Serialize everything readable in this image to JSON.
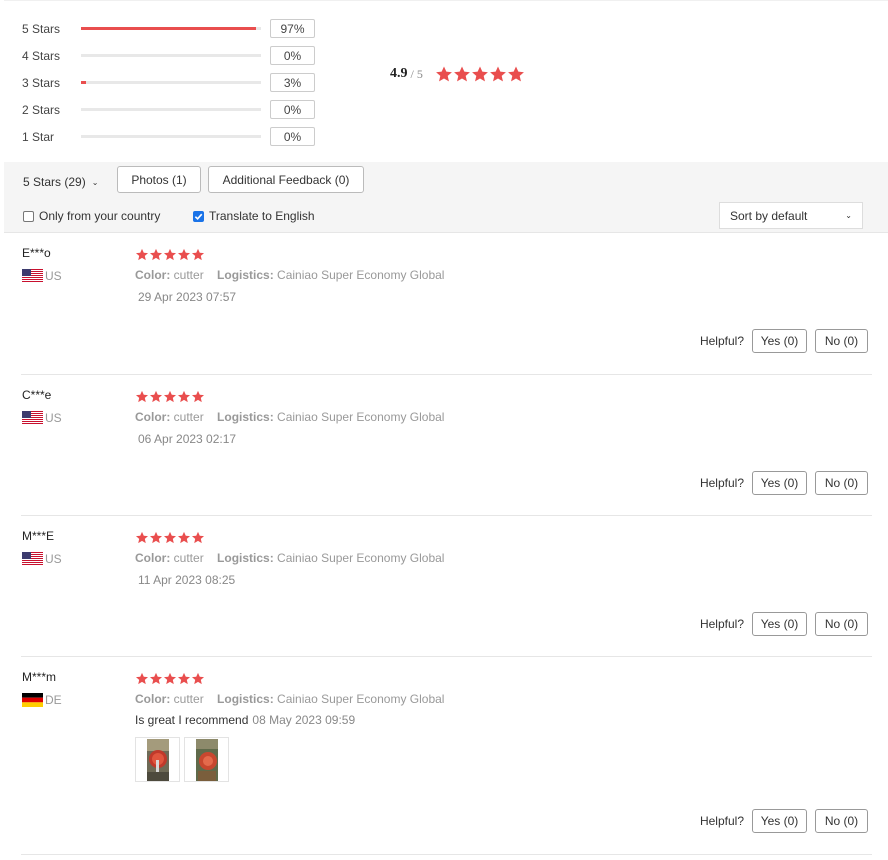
{
  "histogram": [
    {
      "label": "5 Stars",
      "percent_text": "97%",
      "fraction": 0.97
    },
    {
      "label": "4 Stars",
      "percent_text": "0%",
      "fraction": 0.0
    },
    {
      "label": "3 Stars",
      "percent_text": "3%",
      "fraction": 0.03
    },
    {
      "label": "2 Stars",
      "percent_text": "0%",
      "fraction": 0.0
    },
    {
      "label": "1 Star",
      "percent_text": "0%",
      "fraction": 0.0
    }
  ],
  "average": {
    "score": "4.9",
    "total": "/ 5",
    "stars": 5
  },
  "filters": {
    "star_filter": "5 Stars (29)",
    "photos_button": "Photos (1)",
    "feedback_button": "Additional Feedback (0)",
    "only_country_label": "Only from your country",
    "only_country_checked": false,
    "translate_label": "Translate to English",
    "translate_checked": true,
    "sort_label": "Sort by default"
  },
  "colors": {
    "accent": "#e94e4e",
    "checkbox": "#1a73e8"
  },
  "reviews": [
    {
      "name": "E***o",
      "country": "US",
      "flag": "us-flag-icon",
      "rating": 5,
      "color_label": "Color:",
      "color_value": "cutter",
      "logistics_label": "Logistics:",
      "logistics_value": "Cainiao Super Economy Global",
      "date": "29 Apr 2023 07:57",
      "text": "",
      "photos": 0,
      "helpful_label": "Helpful?",
      "yes_label": "Yes (0)",
      "no_label": "No (0)"
    },
    {
      "name": "C***e",
      "country": "US",
      "flag": "us-flag-icon",
      "rating": 5,
      "color_label": "Color:",
      "color_value": "cutter",
      "logistics_label": "Logistics:",
      "logistics_value": "Cainiao Super Economy Global",
      "date": "06 Apr 2023 02:17",
      "text": "",
      "photos": 0,
      "helpful_label": "Helpful?",
      "yes_label": "Yes (0)",
      "no_label": "No (0)"
    },
    {
      "name": "M***E",
      "country": "US",
      "flag": "us-flag-icon",
      "rating": 5,
      "color_label": "Color:",
      "color_value": "cutter",
      "logistics_label": "Logistics:",
      "logistics_value": "Cainiao Super Economy Global",
      "date": "11 Apr 2023 08:25",
      "text": "",
      "photos": 0,
      "helpful_label": "Helpful?",
      "yes_label": "Yes (0)",
      "no_label": "No (0)"
    },
    {
      "name": "M***m",
      "country": "DE",
      "flag": "de-flag-icon",
      "rating": 5,
      "color_label": "Color:",
      "color_value": "cutter",
      "logistics_label": "Logistics:",
      "logistics_value": "Cainiao Super Economy Global",
      "date": "08 May 2023 09:59",
      "text": "Is great I recommend",
      "photos": 2,
      "helpful_label": "Helpful?",
      "yes_label": "Yes (0)",
      "no_label": "No (0)"
    }
  ]
}
